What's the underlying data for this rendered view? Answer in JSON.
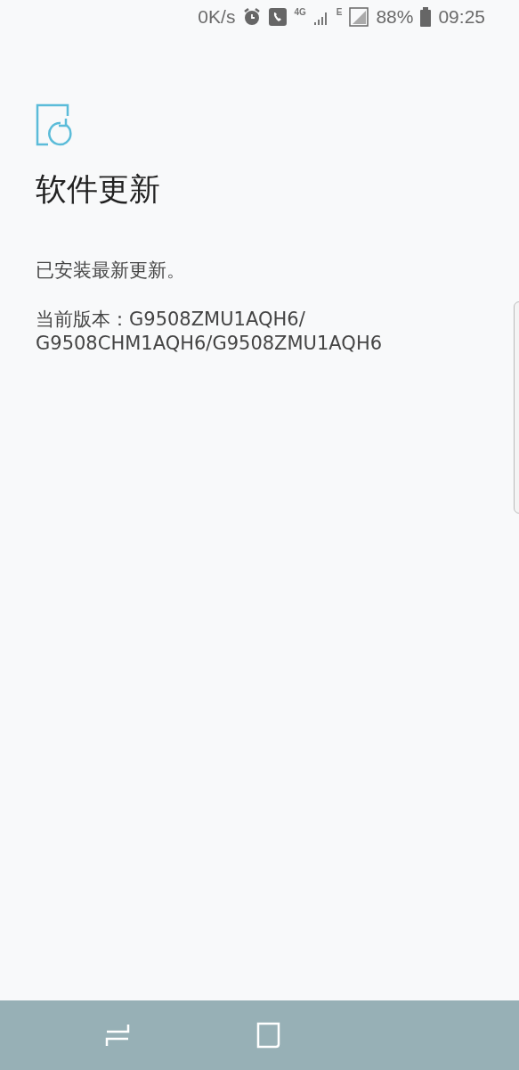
{
  "status_bar": {
    "net_speed": "0K/s",
    "network_type": "4G",
    "second_network": "E",
    "battery": "88%",
    "time": "09:25"
  },
  "title": "软件更新",
  "message": "已安装最新更新。",
  "version_lines": [
    "当前版本：G9508ZMU1AQH6/",
    "G9508CHM1AQH6/G9508ZMU1AQH6"
  ],
  "nav_bar": {
    "buttons": [
      {
        "kind": "recent"
      },
      {
        "kind": "home"
      }
    ]
  }
}
